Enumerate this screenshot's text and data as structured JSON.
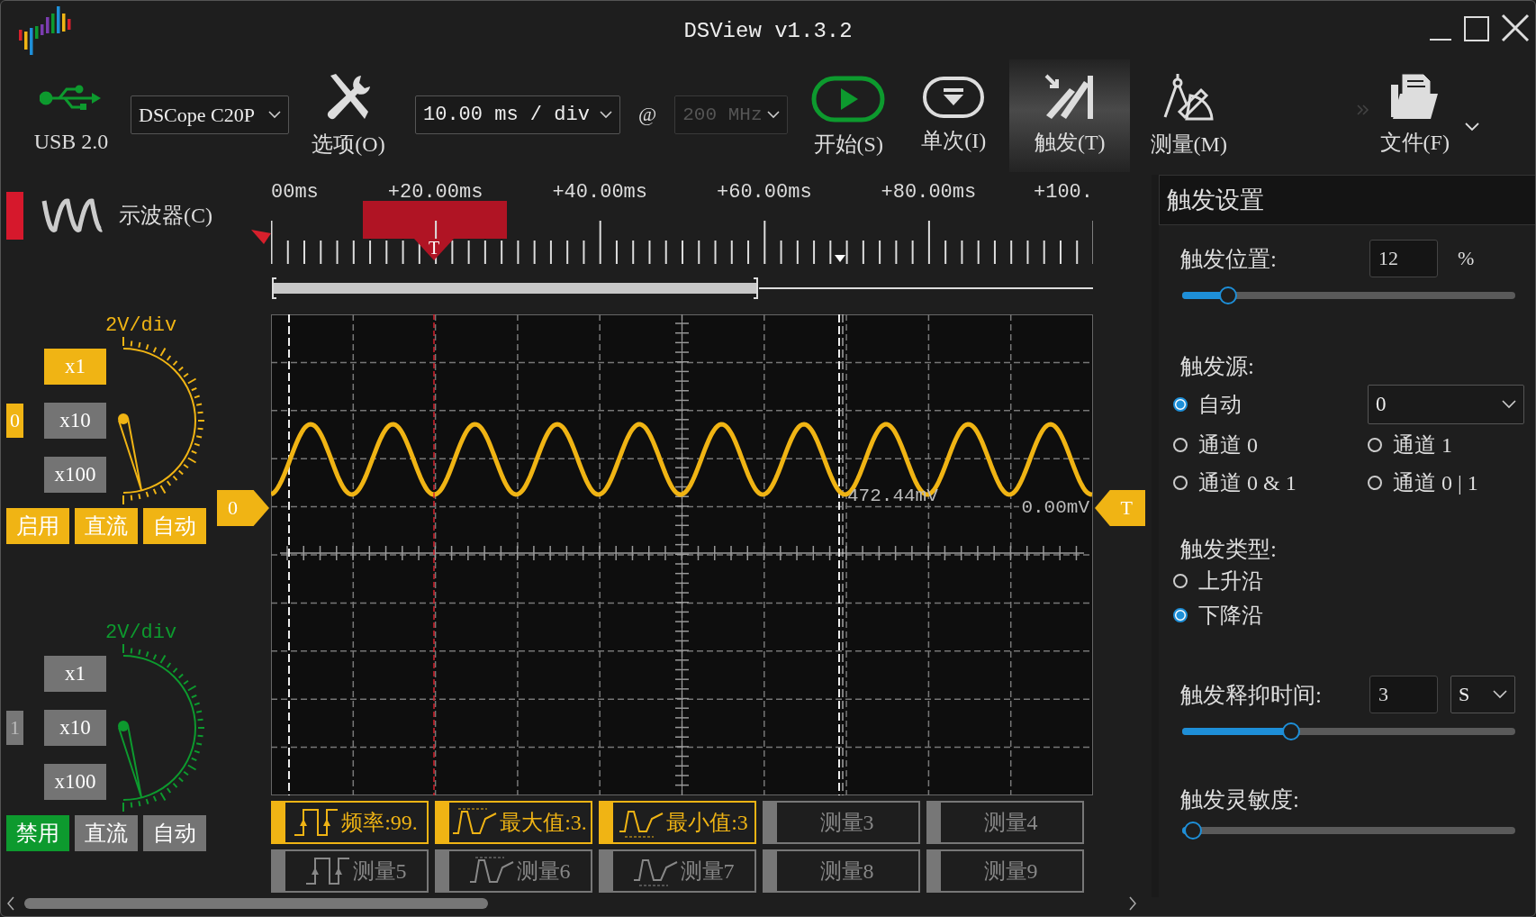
{
  "window": {
    "title": "DSView v1.3.2"
  },
  "toolbar": {
    "usb_label": "USB 2.0",
    "device_select": "DSCope C20P",
    "options_label": "选项(O)",
    "timebase_select": "10.00 ms / div",
    "at_sign": "@",
    "samplerate_select": {
      "value": "200 MHz",
      "disabled": true
    },
    "buttons": [
      {
        "kind": "start",
        "label": "开始(S)",
        "selected": false
      },
      {
        "kind": "single",
        "label": "单次(I)",
        "selected": false
      },
      {
        "kind": "trigger",
        "label": "触发(T)",
        "selected": true
      },
      {
        "kind": "measure",
        "label": "测量(M)",
        "selected": false
      },
      {
        "kind": "file",
        "label": "文件(F)",
        "selected": false
      }
    ]
  },
  "channel_panel": {
    "title": "示波器(C)",
    "channels": [
      {
        "index": "0",
        "scale": "2V/div",
        "color": "#f0b414",
        "enabled": true,
        "enable_label": "启用",
        "coupling": "直流",
        "mode": "自动",
        "multipliers": [
          {
            "label": "x1",
            "selected": true
          },
          {
            "label": "x10",
            "selected": false
          },
          {
            "label": "x100",
            "selected": false
          }
        ]
      },
      {
        "index": "1",
        "scale": "2V/div",
        "color": "#0d9a2e",
        "enabled": false,
        "enable_label": "禁用",
        "coupling": "直流",
        "mode": "自动",
        "multipliers": [
          {
            "label": "x1",
            "selected": false
          },
          {
            "label": "x10",
            "selected": false
          },
          {
            "label": "x100",
            "selected": false
          }
        ]
      }
    ]
  },
  "ruler": {
    "labels": [
      "00ms",
      "+20.00ms",
      "+40.00ms",
      "+60.00ms",
      "+80.00ms",
      "+100."
    ],
    "trigger_marker": "T"
  },
  "plot": {
    "channel_marker": "0",
    "trigger_marker": "T",
    "cursor_readout": "472.44mV",
    "level_readout": "0.00mV"
  },
  "measurements": [
    {
      "kind": "frequency",
      "label": "频率:99.",
      "active": true
    },
    {
      "kind": "maximum",
      "label": "最大值:3.",
      "active": true
    },
    {
      "kind": "minimum",
      "label": "最小值:3",
      "active": true
    },
    {
      "kind": "none",
      "label": "测量3",
      "active": false
    },
    {
      "kind": "none",
      "label": "测量4",
      "active": false
    },
    {
      "kind": "frequency",
      "label": "测量5",
      "active": false
    },
    {
      "kind": "maximum",
      "label": "测量6",
      "active": false
    },
    {
      "kind": "minimum",
      "label": "测量7",
      "active": false
    },
    {
      "kind": "none",
      "label": "测量8",
      "active": false
    },
    {
      "kind": "none",
      "label": "测量9",
      "active": false
    }
  ],
  "trigger_panel": {
    "title": "触发设置",
    "position": {
      "label": "触发位置:",
      "value": "12",
      "unit": "%",
      "level": 0.13
    },
    "source": {
      "label": "触发源:",
      "select": "0",
      "options": [
        {
          "label": "自动",
          "selected": true
        },
        {
          "label": "通道 0",
          "selected": false
        },
        {
          "label": "通道 1",
          "selected": false
        },
        {
          "label": "通道 0 & 1",
          "selected": false
        },
        {
          "label": "通道 0 | 1",
          "selected": false
        }
      ]
    },
    "type": {
      "label": "触发类型:",
      "options": [
        {
          "label": "上升沿",
          "selected": false
        },
        {
          "label": "下降沿",
          "selected": true
        }
      ]
    },
    "holdoff": {
      "label": "触发释抑时间:",
      "value": "3",
      "unit": "S",
      "level": 0.31
    },
    "sensitivity": {
      "label": "触发灵敏度:",
      "level": 0.03
    }
  }
}
